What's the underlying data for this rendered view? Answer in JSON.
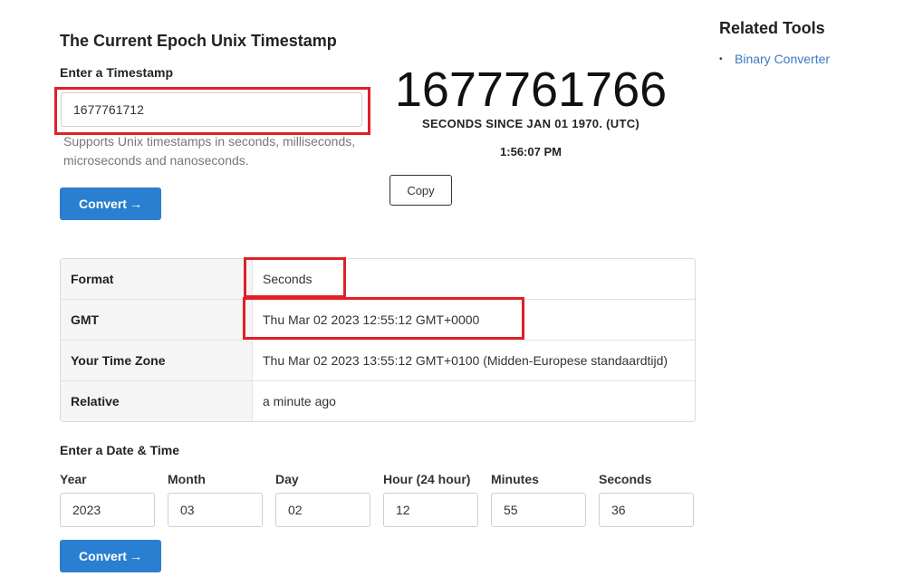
{
  "main": {
    "title": "The Current Epoch Unix Timestamp",
    "timestamp_label": "Enter a Timestamp",
    "timestamp_value": "1677761712",
    "timestamp_help": "Supports Unix timestamps in seconds, milliseconds, microseconds and nanoseconds.",
    "convert_label": "Convert",
    "convert_arrow": "→"
  },
  "current": {
    "timestamp": "1677761766",
    "subtitle": "SECONDS SINCE JAN 01 1970. (UTC)",
    "time": "1:56:07 PM",
    "copy_label": "Copy"
  },
  "results": [
    {
      "key": "Format",
      "value": "Seconds"
    },
    {
      "key": "GMT",
      "value": "Thu Mar 02 2023 12:55:12 GMT+0000"
    },
    {
      "key": "Your Time Zone",
      "value": "Thu Mar 02 2023 13:55:12 GMT+0100 (Midden-Europese standaardtijd)"
    },
    {
      "key": "Relative",
      "value": "a minute ago"
    }
  ],
  "datetime": {
    "label": "Enter a Date & Time",
    "fields": [
      {
        "label": "Year",
        "value": "2023"
      },
      {
        "label": "Month",
        "value": "03"
      },
      {
        "label": "Day",
        "value": "02"
      },
      {
        "label": "Hour (24 hour)",
        "value": "12"
      },
      {
        "label": "Minutes",
        "value": "55"
      },
      {
        "label": "Seconds",
        "value": "36"
      }
    ],
    "convert_label": "Convert",
    "convert_arrow": "→"
  },
  "sidebar": {
    "title": "Related Tools",
    "items": [
      {
        "bullet": "•",
        "label": "Binary Converter"
      }
    ]
  },
  "colors": {
    "primary_button": "#2a7fd0",
    "highlight": "#e02027",
    "link": "#3b7ac2"
  }
}
